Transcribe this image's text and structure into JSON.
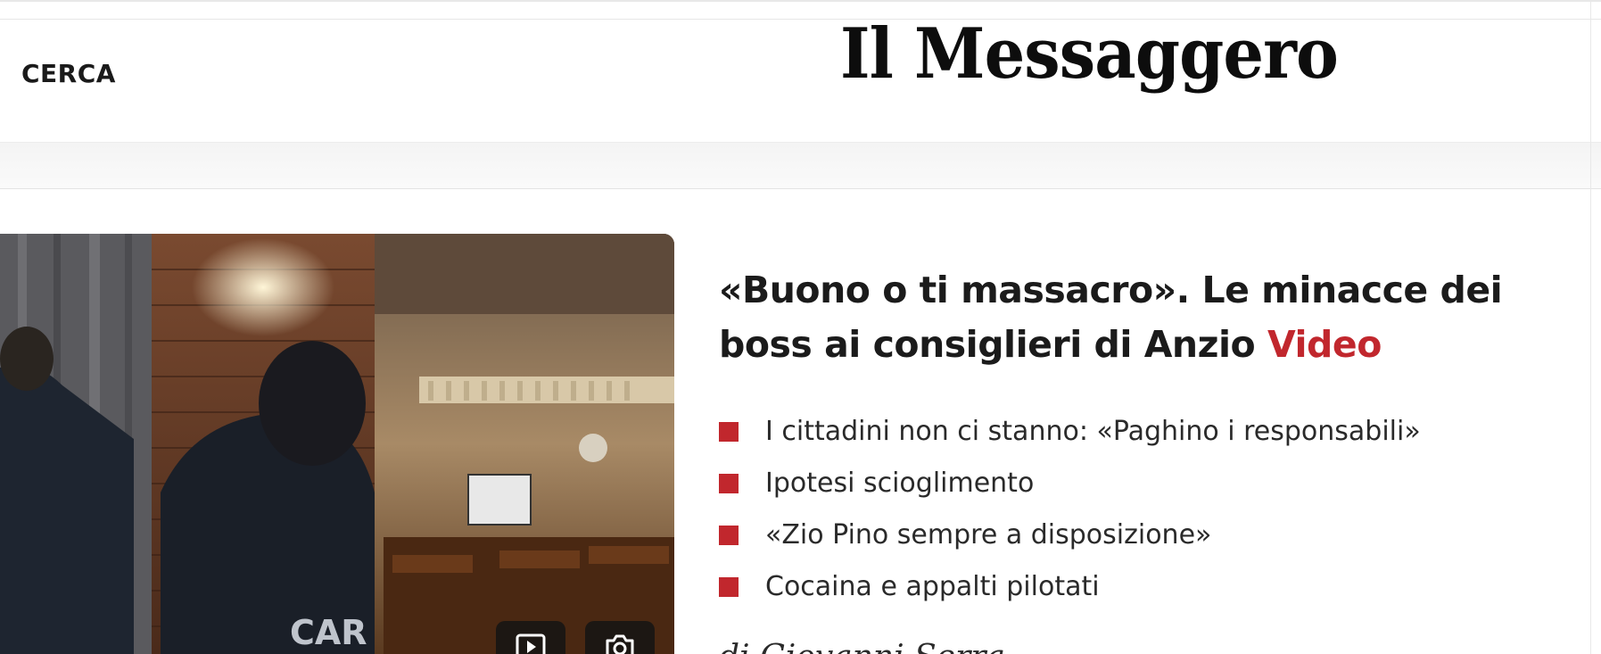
{
  "header": {
    "search_label": "CERCA",
    "logo_text": "Il Messaggero"
  },
  "article": {
    "headline_main": "«Buono o ti massacro». Le minacce dei boss ai consiglieri di Anzio",
    "headline_tag": "Video",
    "related": [
      {
        "label": "I cittadini non ci stanno: «Paghino i responsabili»"
      },
      {
        "label": "Ipotesi scioglimento"
      },
      {
        "label": "«Zio Pino sempre a disposizione»"
      },
      {
        "label": "Cocaina e appalti pilotati"
      }
    ],
    "byline": "di Giovanni Serra"
  },
  "media": {
    "video_icon": "play-icon",
    "photo_icon": "camera-icon"
  },
  "colors": {
    "accent": "#c1272d",
    "text": "#1b1b1b",
    "band": "#f4f4f4"
  }
}
